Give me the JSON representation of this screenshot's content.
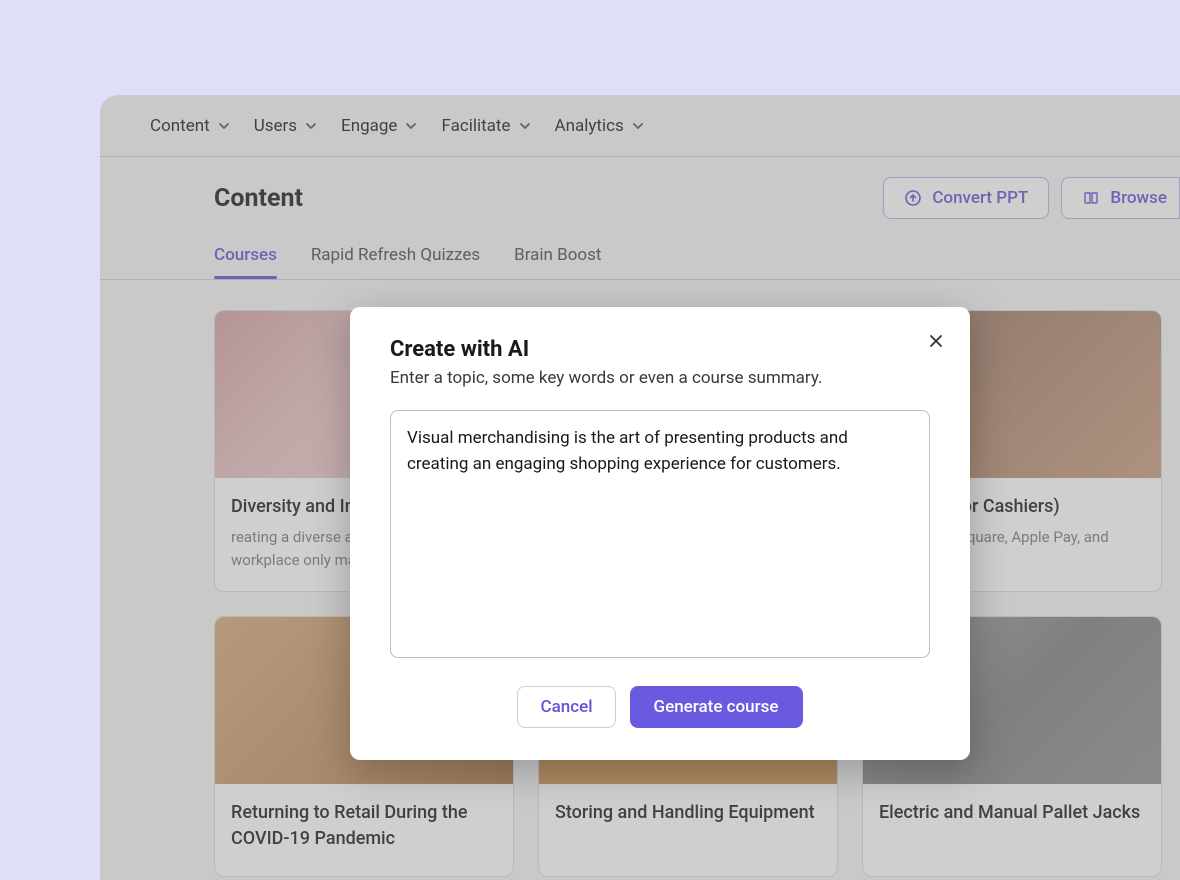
{
  "nav": [
    {
      "label": "Content"
    },
    {
      "label": "Users"
    },
    {
      "label": "Engage"
    },
    {
      "label": "Facilitate"
    },
    {
      "label": "Analytics"
    }
  ],
  "page_title": "Content",
  "actions": {
    "convert": "Convert PPT",
    "browse": "Browse"
  },
  "tabs": [
    {
      "label": "Courses",
      "active": true
    },
    {
      "label": "Rapid Refresh Quizzes",
      "active": false
    },
    {
      "label": "Brain Boost",
      "active": false
    }
  ],
  "cards": [
    {
      "title": "Diversity and Inclusion in Retail",
      "desc": "reating a diverse and inclusive workplace only makes us stronger..."
    },
    {
      "title": "",
      "desc": ""
    },
    {
      "title": "Security (for Cashiers)",
      "desc": "How to use Square, Apple Pay, and contactless..."
    },
    {
      "title": "Returning to Retail During the COVID-19 Pandemic",
      "desc": ""
    },
    {
      "title": "Storing and Handling Equipment",
      "desc": ""
    },
    {
      "title": "Electric and Manual Pallet Jacks",
      "desc": ""
    }
  ],
  "modal": {
    "title": "Create with AI",
    "subtitle": "Enter a topic, some key words or even a course summary.",
    "value": "Visual merchandising is the art of presenting products and creating an engaging shopping experience for customers.",
    "cancel": "Cancel",
    "generate": "Generate course"
  }
}
